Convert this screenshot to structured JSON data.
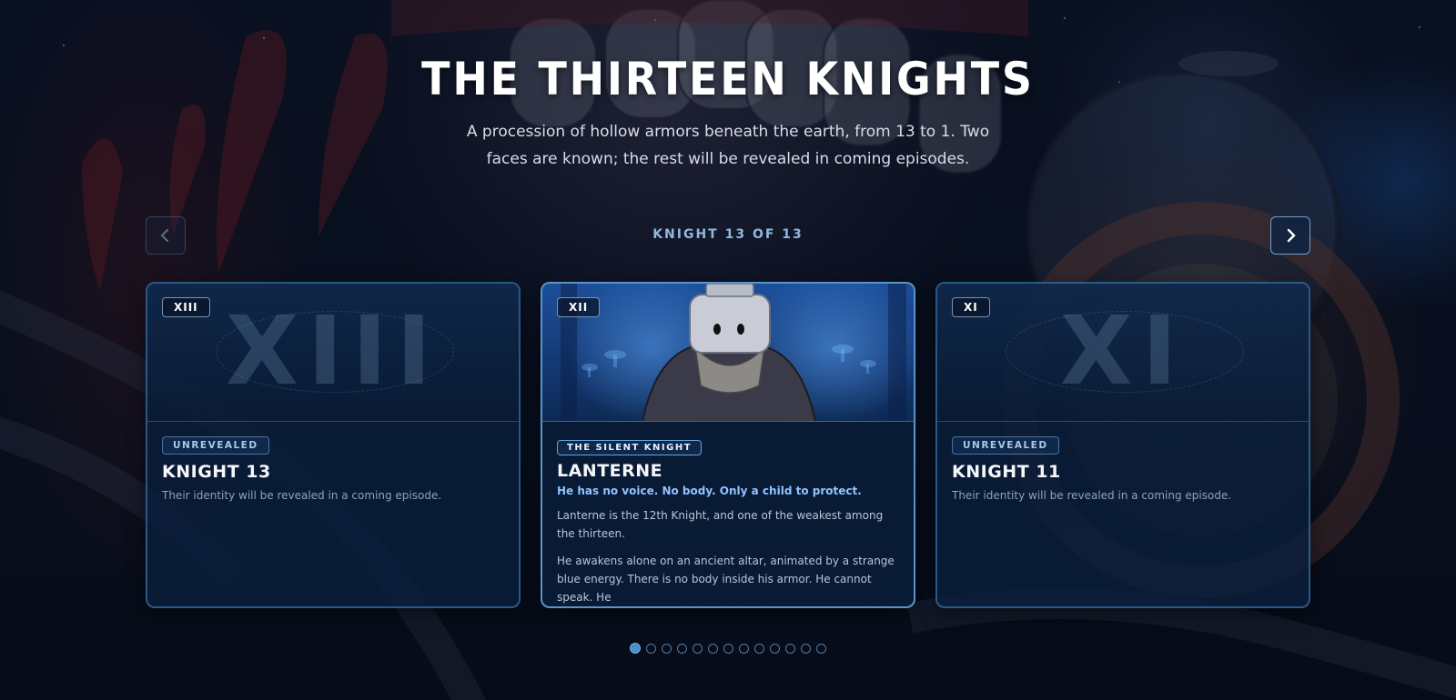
{
  "colors": {
    "accent": "#8fb8dc",
    "card_border": "#3f8cc8",
    "tagline": "#8fc4ff",
    "dot_active": "#4a8fc8"
  },
  "hero": {
    "title": "THE THIRTEEN KNIGHTS",
    "subtitle": "A procession of hollow armors beneath the earth, from 13 to 1. Two faces are known; the rest will be revealed in coming episodes."
  },
  "carousel": {
    "counter": "KNIGHT 13 OF 13",
    "prev_icon": "chevron-left-icon",
    "next_icon": "chevron-right-icon",
    "total": 13,
    "current_index": 0
  },
  "cards": [
    {
      "numeral": "XIII",
      "status": "UNREVEALED",
      "name": "KNIGHT 13",
      "description": "Their identity will be revealed in a coming episode."
    },
    {
      "numeral": "XII",
      "status": "THE SILENT KNIGHT",
      "name": "LANTERNE",
      "tagline": "He has no voice. No body. Only a child to protect.",
      "paragraph1": "Lanterne is the 12th Knight, and one of the weakest among the thirteen.",
      "paragraph2": "He awakens alone on an ancient altar, animated by a strange blue energy. There is no body inside his armor. He cannot speak. He"
    },
    {
      "numeral": "XI",
      "status": "UNREVEALED",
      "name": "KNIGHT 11",
      "description": "Their identity will be revealed in a coming episode."
    }
  ]
}
